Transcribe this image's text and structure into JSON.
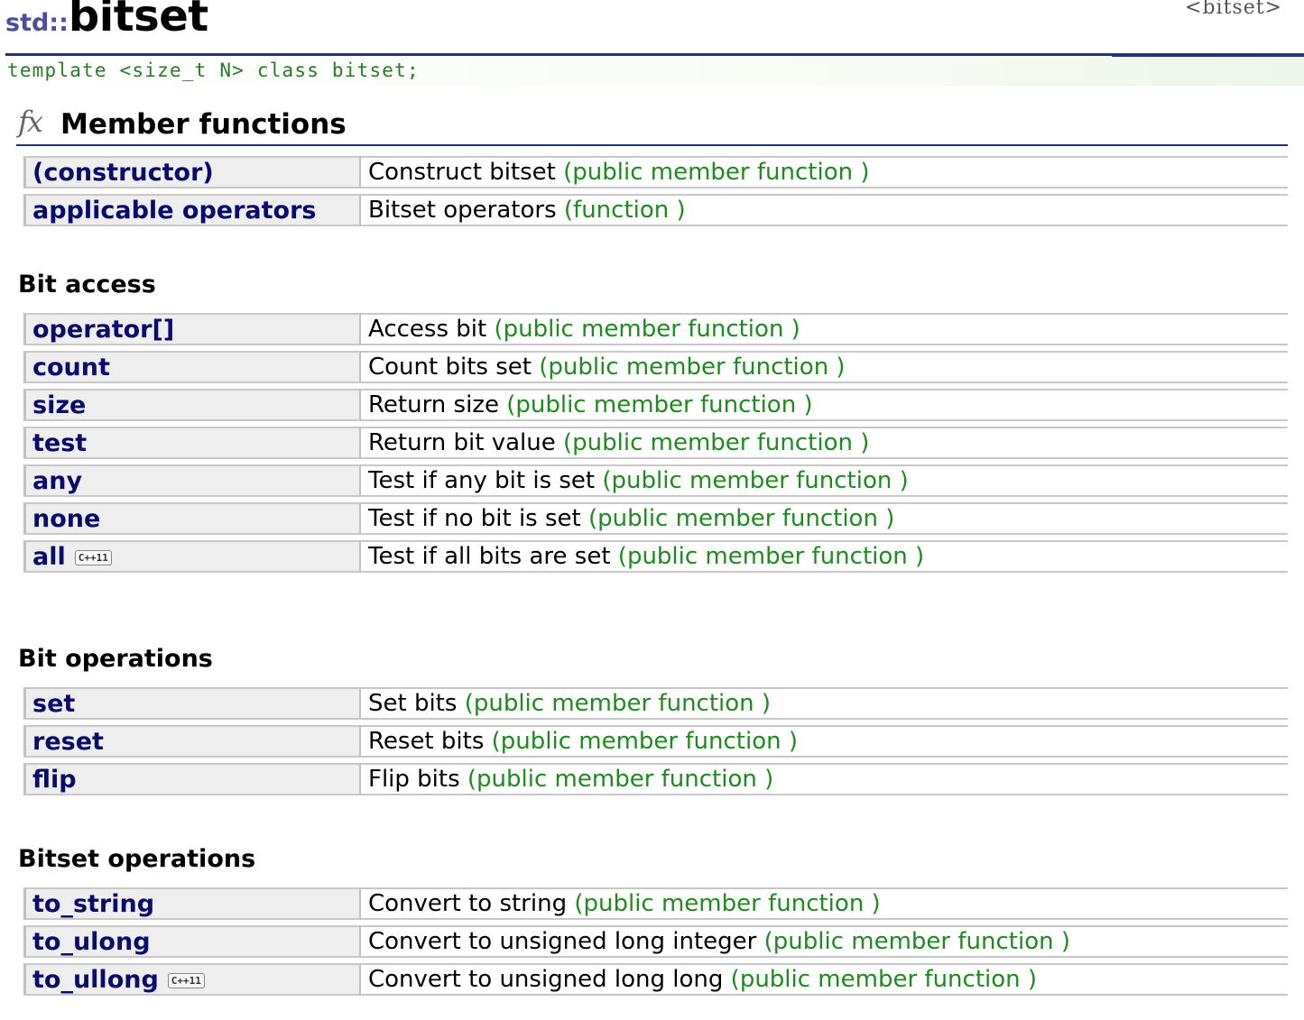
{
  "header": {
    "tag": "<bitset>",
    "namespace": "std::",
    "title": "bitset",
    "declaration": "template <size_t N> class bitset;"
  },
  "section": {
    "icon": "fx-icon",
    "title": "Member functions"
  },
  "groups": [
    {
      "title": "",
      "rows": [
        {
          "name": "(constructor)",
          "badge": "",
          "desc": "Construct bitset",
          "kind": "(public member function )"
        },
        {
          "name": "applicable operators",
          "badge": "",
          "desc": "Bitset operators",
          "kind": "(function )"
        }
      ]
    },
    {
      "title": "Bit access",
      "rows": [
        {
          "name": "operator[]",
          "badge": "",
          "desc": "Access bit",
          "kind": "(public member function )"
        },
        {
          "name": "count",
          "badge": "",
          "desc": "Count bits set",
          "kind": "(public member function )"
        },
        {
          "name": "size",
          "badge": "",
          "desc": "Return size",
          "kind": "(public member function )"
        },
        {
          "name": "test",
          "badge": "",
          "desc": "Return bit value",
          "kind": "(public member function )"
        },
        {
          "name": "any",
          "badge": "",
          "desc": "Test if any bit is set",
          "kind": "(public member function )"
        },
        {
          "name": "none",
          "badge": "",
          "desc": "Test if no bit is set",
          "kind": "(public member function )"
        },
        {
          "name": "all",
          "badge": "C++11",
          "desc": "Test if all bits are set",
          "kind": "(public member function )"
        }
      ]
    },
    {
      "title": "Bit operations",
      "rows": [
        {
          "name": "set",
          "badge": "",
          "desc": "Set bits",
          "kind": "(public member function )"
        },
        {
          "name": "reset",
          "badge": "",
          "desc": "Reset bits",
          "kind": "(public member function )"
        },
        {
          "name": "flip",
          "badge": "",
          "desc": "Flip bits",
          "kind": "(public member function )"
        }
      ]
    },
    {
      "title": "Bitset operations",
      "rows": [
        {
          "name": "to_string",
          "badge": "",
          "desc": "Convert to string",
          "kind": "(public member function )"
        },
        {
          "name": "to_ulong",
          "badge": "",
          "desc": "Convert to unsigned long integer",
          "kind": "(public member function )"
        },
        {
          "name": "to_ullong",
          "badge": "C++11",
          "desc": "Convert to unsigned long long",
          "kind": "(public member function )"
        }
      ]
    }
  ]
}
